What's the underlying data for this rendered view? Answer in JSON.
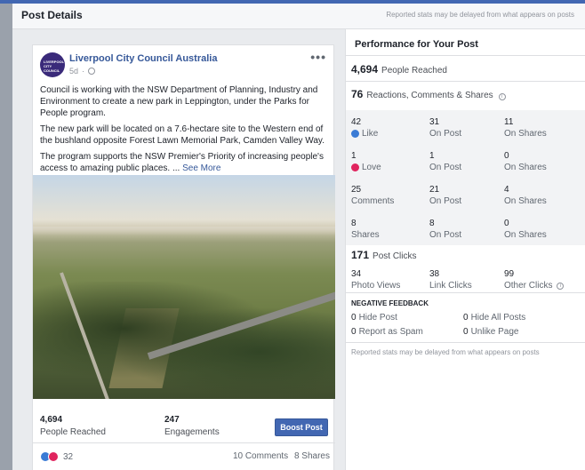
{
  "header": {
    "title": "Post Details",
    "note": "Reported stats may be delayed from what appears on posts"
  },
  "post": {
    "page_name": "Liverpool City Council Australia",
    "avatar_text": "LIVERPOOL CITY COUNCIL",
    "time": "5d",
    "more_icon": "more-dots-icon",
    "paragraphs": [
      "Council is working with the NSW Department of Planning, Industry and Environment to create a new park in Leppington, under the Parks for People program.",
      "The new park will be located on a 7.6-hectare site to the Western end of the bushland opposite Forest Lawn Memorial Park, Camden Valley Way.",
      "The program supports the NSW Premier's Priority of increasing people's access to amazing public places. ..."
    ],
    "see_more": "See More",
    "people_reached_value": "4,694",
    "people_reached_label": "People Reached",
    "engagements_value": "247",
    "engagements_label": "Engagements",
    "boost_label": "Boost Post",
    "reactions_count": "32",
    "comments": "10 Comments",
    "shares": "8 Shares"
  },
  "performance": {
    "title": "Performance for Your Post",
    "reached_value": "4,694",
    "reached_label": "People Reached",
    "reactions_value": "76",
    "reactions_label": "Reactions, Comments & Shares",
    "rows": [
      [
        {
          "v": "42",
          "l": "Like"
        },
        {
          "v": "31",
          "l": "On Post"
        },
        {
          "v": "11",
          "l": "On Shares"
        }
      ],
      [
        {
          "v": "1",
          "l": "Love"
        },
        {
          "v": "1",
          "l": "On Post"
        },
        {
          "v": "0",
          "l": "On Shares"
        }
      ],
      [
        {
          "v": "25",
          "l": "Comments"
        },
        {
          "v": "21",
          "l": "On Post"
        },
        {
          "v": "4",
          "l": "On Shares"
        }
      ],
      [
        {
          "v": "8",
          "l": "Shares"
        },
        {
          "v": "8",
          "l": "On Post"
        },
        {
          "v": "0",
          "l": "On Shares"
        }
      ]
    ],
    "clicks_value": "171",
    "clicks_label": "Post Clicks",
    "clicks": [
      {
        "v": "34",
        "l": "Photo Views"
      },
      {
        "v": "38",
        "l": "Link Clicks"
      },
      {
        "v": "99",
        "l": "Other Clicks"
      }
    ],
    "negative_title": "NEGATIVE FEEDBACK",
    "negative": [
      {
        "v": "0",
        "l": "Hide Post"
      },
      {
        "v": "0",
        "l": "Hide All Posts"
      },
      {
        "v": "0",
        "l": "Report as Spam"
      },
      {
        "v": "0",
        "l": "Unlike Page"
      }
    ],
    "note": "Reported stats may be delayed from what appears on posts"
  },
  "colors": {
    "brand": "#4267b2",
    "link": "#365899",
    "like": "#3a7bd5",
    "love": "#e0245e"
  }
}
